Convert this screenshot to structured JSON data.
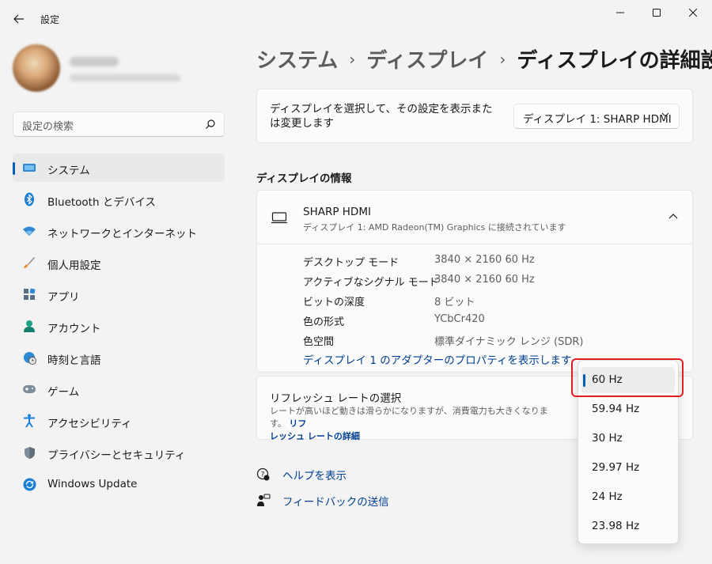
{
  "window": {
    "title": "設定"
  },
  "profile": {
    "name": "",
    "email": ""
  },
  "search": {
    "placeholder": "設定の検索"
  },
  "sidebar": {
    "items": [
      {
        "label": "システム",
        "icon": "system-icon",
        "selected": true
      },
      {
        "label": "Bluetooth とデバイス",
        "icon": "bluetooth-icon"
      },
      {
        "label": "ネットワークとインターネット",
        "icon": "wifi-icon"
      },
      {
        "label": "個人用設定",
        "icon": "brush-icon"
      },
      {
        "label": "アプリ",
        "icon": "apps-icon"
      },
      {
        "label": "アカウント",
        "icon": "account-icon"
      },
      {
        "label": "時刻と言語",
        "icon": "time-language-icon"
      },
      {
        "label": "ゲーム",
        "icon": "gamepad-icon"
      },
      {
        "label": "アクセシビリティ",
        "icon": "accessibility-icon"
      },
      {
        "label": "プライバシーとセキュリティ",
        "icon": "shield-icon"
      },
      {
        "label": "Windows Update",
        "icon": "windows-update-icon"
      }
    ]
  },
  "breadcrumb": {
    "level1": "システム",
    "level2": "ディスプレイ",
    "current": "ディスプレイの詳細設定",
    "separator": "›"
  },
  "display_select": {
    "label": "ディスプレイを選択して、その設定を表示または変更します",
    "value": "ディスプレイ 1: SHARP HDMI"
  },
  "display_info": {
    "section_title": "ディスプレイの情報",
    "name": "SHARP HDMI",
    "subtitle": "ディスプレイ 1: AMD Radeon(TM) Graphics に接続されています",
    "rows": [
      {
        "key": "デスクトップ モード",
        "value": "3840 × 2160 60 Hz"
      },
      {
        "key": "アクティブなシグナル モード",
        "value": "3840 × 2160 60 Hz"
      },
      {
        "key": "ビットの深度",
        "value": "8 ビット"
      },
      {
        "key": "色の形式",
        "value": "YCbCr420"
      },
      {
        "key": "色空間",
        "value": "標準ダイナミック レンジ (SDR)"
      }
    ],
    "adapter_link": "ディスプレイ 1 のアダプターのプロパティを表示します"
  },
  "refresh_rate": {
    "title": "リフレッシュ レートの選択",
    "description": "レートが高いほど動きは滑らかになりますが、消費電力も大きくなります。",
    "link_part1": "リフ",
    "link_part2": "レッシュ レートの詳細",
    "options": [
      "60 Hz",
      "59.94 Hz",
      "30 Hz",
      "29.97 Hz",
      "24 Hz",
      "23.98 Hz"
    ],
    "selected": "60 Hz"
  },
  "help": {
    "help_label": "ヘルプを表示",
    "feedback_label": "フィードバックの送信"
  },
  "colors": {
    "accent": "#005fb8",
    "link": "#003e92",
    "highlight": "#e02020"
  }
}
